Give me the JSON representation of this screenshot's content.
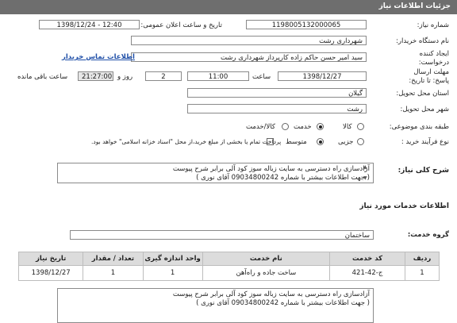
{
  "header": {
    "title": "جزئیات اطلاعات نیاز"
  },
  "fields": {
    "need_number": {
      "label": "شماره نیاز:",
      "value": "1198005132000065"
    },
    "announce": {
      "label": "تاریخ و ساعت اعلان عمومی:",
      "value": "1398/12/24 - 12:40"
    },
    "buyer_org": {
      "label": "نام دستگاه خریدار:",
      "value": "شهرداری رشت"
    },
    "requester": {
      "label": "ایجاد کننده درخواست:",
      "value": "سید امیر حسن حاکم زاده کارپرداز  شهرداری رشت",
      "contact_link": "اطلاعات تماس خریدار"
    },
    "deadline": {
      "label": "مهلت ارسال پاسخ: تا تاریخ:",
      "date": "1398/12/27",
      "time_label": "ساعت",
      "time": "11:00",
      "days": "2",
      "days_label": "روز و",
      "remain": "21:27:00",
      "remain_label": "ساعت باقی مانده"
    },
    "province": {
      "label": "استان محل تحویل:",
      "value": "گیلان"
    },
    "city": {
      "label": "شهر محل تحویل:",
      "value": "رشت"
    },
    "category": {
      "label": "طبقه بندی موضوعی:",
      "options": [
        "کالا",
        "خدمت",
        "کالا/خدمت"
      ],
      "selected": "خدمت"
    },
    "process": {
      "label": "نوع فرآیند خرید :",
      "options": [
        "جزیی",
        "متوسط"
      ],
      "selected": "متوسط",
      "payment_note": "پرداخت تمام یا بخشی از مبلغ خرید،از محل \"اسناد خزانه اسلامی\" خواهد بود."
    }
  },
  "summary": {
    "label": "شرح کلی نیاز:",
    "line1": "آزادسازی راه دسترسی به سایت زباله سوز کود آلی برابر شرح پیوست",
    "line2": "( جهت اطلاعات بیشتر با شماره 09034800242 آقای نوری )"
  },
  "services_section": {
    "title": "اطلاعات خدمات مورد نیاز"
  },
  "service_group": {
    "label": "گروه خدمت:",
    "value": "ساختمان"
  },
  "table": {
    "headers": [
      "ردیف",
      "کد خدمت",
      "نام خدمت",
      "واحد اندازه گیری",
      "تعداد / مقدار",
      "تاریخ نیاز"
    ],
    "rows": [
      [
        "1",
        "ج-42-421",
        "ساخت جاده و راه‌آهن",
        "1",
        "1",
        "1398/12/27"
      ]
    ]
  },
  "notes": {
    "line1": "آزادسازی راه دسترسی به سایت زباله سوز کود آلی برابر شرح پیوست",
    "line2": "( جهت اطلاعات بیشتر با شماره 09034800242 آقای نوری )"
  }
}
